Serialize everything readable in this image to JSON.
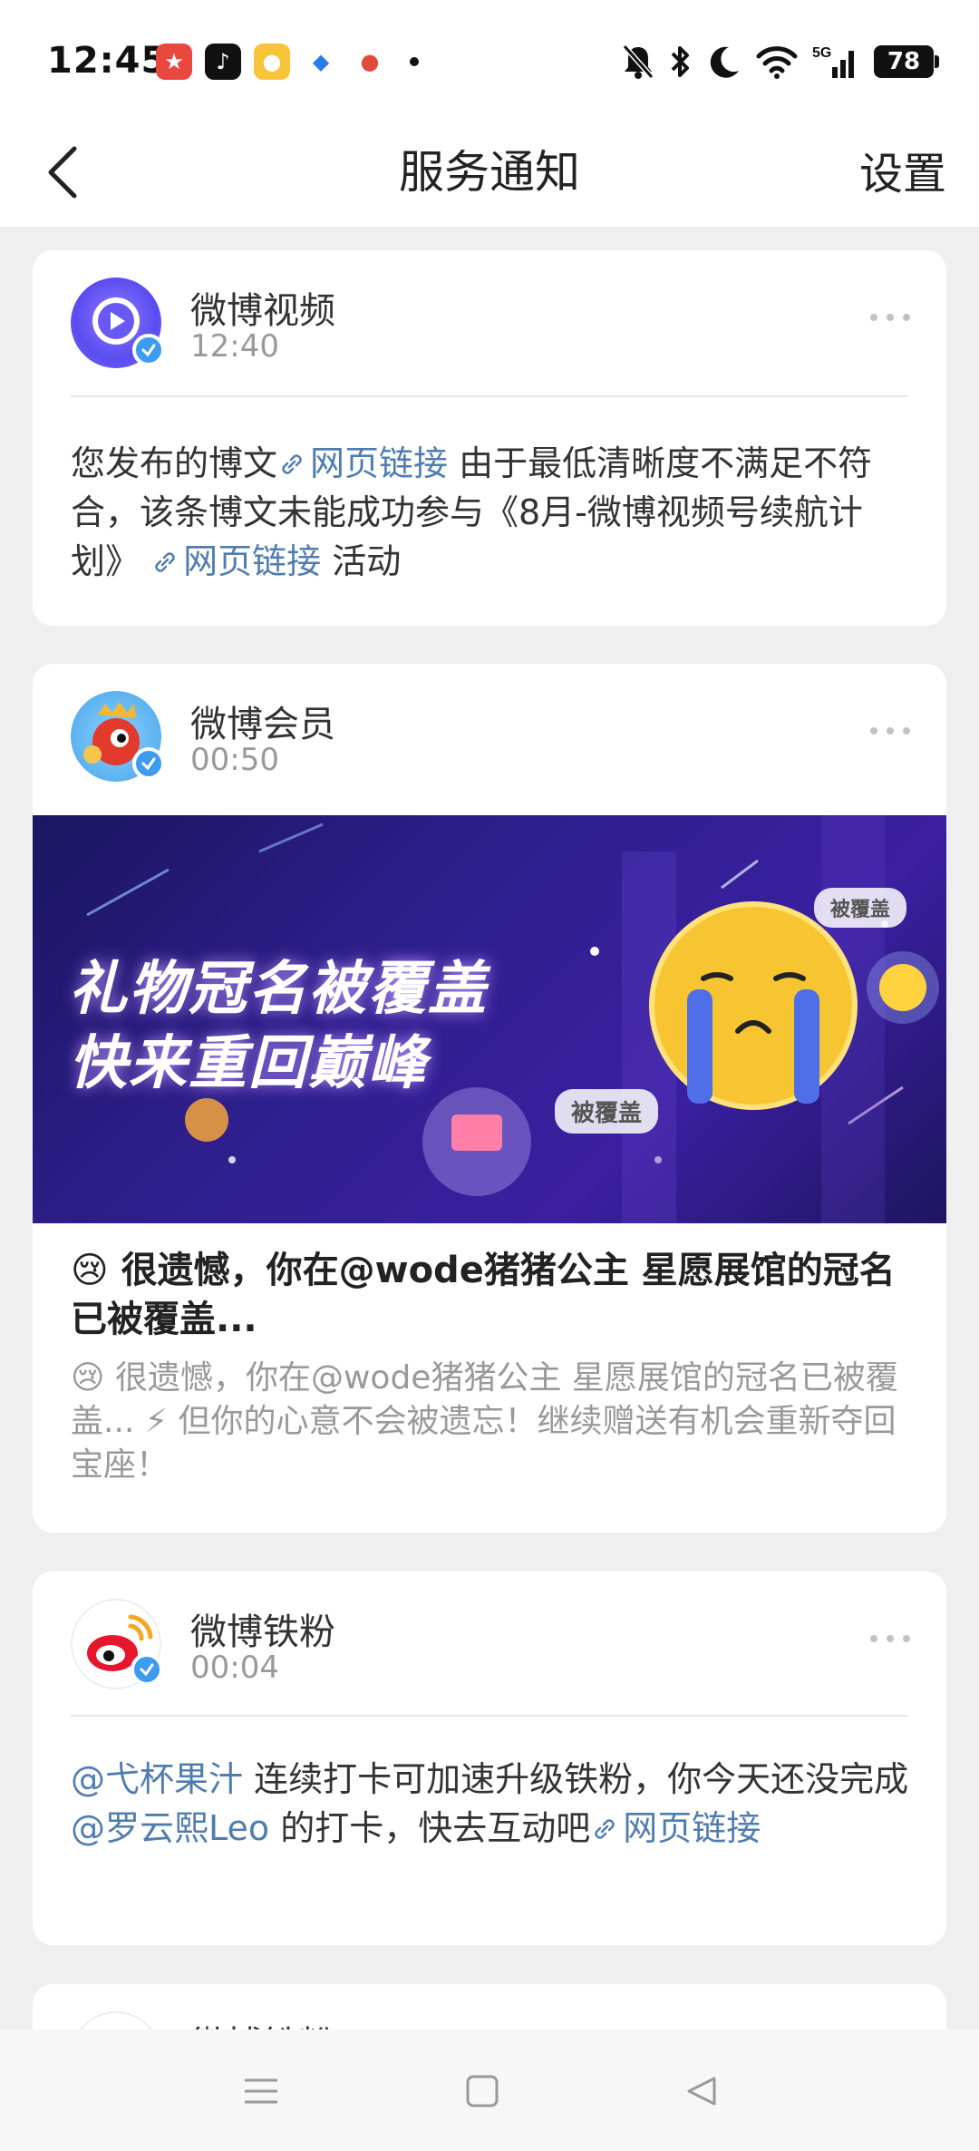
{
  "status_bar": {
    "time": "12:45",
    "battery": "78",
    "network": "5G",
    "app_icons": [
      "game-app-icon",
      "tiktok-icon",
      "weibo-icon",
      "browser-app-icon",
      "map-app-icon"
    ],
    "system_icons": [
      "mute-icon",
      "bluetooth-icon",
      "moon-icon",
      "wifi-icon",
      "signal-icon"
    ]
  },
  "nav": {
    "title": "服务通知",
    "settings_label": "设置"
  },
  "notifications": [
    {
      "sender": "微博视频",
      "time": "12:40",
      "body_parts": {
        "p1": "您发布的博文",
        "link1": "网页链接",
        "p2": " 由于最低清晰度不满足不符合，该条博文未能成功参与《8月-微博视频号续航计划》",
        "link2": "网页链接",
        "p3": " 活动"
      }
    },
    {
      "sender": "微博会员",
      "time": "00:50",
      "banner": {
        "line1": "礼物冠名被覆盖",
        "line2": "快来重回巅峰",
        "tag1": "被覆盖",
        "tag2": "被覆盖"
      },
      "title": "😢 很遗憾，你在@wode猪猪公主 星愿展馆的冠名已被覆盖...",
      "desc": "😢 很遗憾，你在@wode猪猪公主 星愿展馆的冠名已被覆盖... ⚡ 但你的心意不会被遗忘！继续赠送有机会重新夺回宝座！"
    },
    {
      "sender": "微博铁粉",
      "time": "00:04",
      "body_parts": {
        "mention1": "@弋杯果汁",
        "p1": " 连续打卡可加速升级铁粉，你今天还没完成",
        "mention2": "@罗云熙Leo",
        "p2": " 的打卡，快去互动吧",
        "link1": "网页链接"
      }
    },
    {
      "sender": "微博铁粉"
    }
  ],
  "colors": {
    "link": "#507daf",
    "background": "#efefef",
    "verified": "#3e9cf0"
  }
}
